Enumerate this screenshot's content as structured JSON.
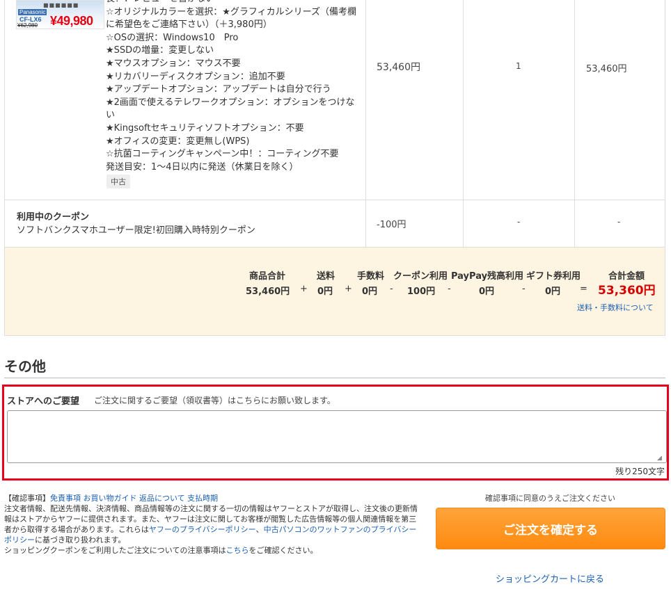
{
  "product": {
    "thumb_brand": "Panasonic",
    "thumb_model": "CF-LX6",
    "thumb_old_price": "¥62,980",
    "thumb_price": "¥49,980",
    "options": [
      "長！：レビューを書かない",
      "☆オリジナルカラーを選択：★グラフィカルシリーズ（備考欄に希望色をご連絡下さい）（＋3,980円）",
      "☆OSの選択：Windows10　Pro",
      "★SSDの増量：変更しない",
      "★マウスオプション：マウス不要",
      "★リカバリーディスクオプション：追加不要",
      "★アップデートオプション：アップデートは自分で行う",
      "★2画面で使えるテレワークオプション：オプションをつけない",
      "★Kingsoftセキュリティソフトオプション：不要",
      "★オフィスの変更：変更無し(WPS)",
      "☆抗菌コーティングキャンペーン中！：コーティング不要",
      "発送目安：1〜4日以内に発送（休業日を除く）"
    ],
    "condition_tag": "中古",
    "unit_price": "53,460円",
    "quantity": "1",
    "subtotal": "53,460円"
  },
  "coupon": {
    "title": "利用中のクーポン",
    "description": "ソフトバンクスマホユーザー限定!初回購入時特別クーポン",
    "discount": "-100円",
    "quantity": "-",
    "subtotal": "-"
  },
  "totals": {
    "headers": {
      "goods": "商品合計",
      "shipping": "送料",
      "fee": "手数料",
      "coupon": "クーポン利用",
      "paypay": "PayPay残高利用",
      "gift": "ギフト券利用",
      "total": "合計金額"
    },
    "values": {
      "goods": "53,460円",
      "shipping": "0円",
      "fee": "0円",
      "coupon": "100円",
      "paypay": "0円",
      "gift": "0円",
      "total": "53,360円"
    },
    "operators": [
      "+",
      "+",
      "-",
      "-",
      "-",
      "="
    ],
    "fee_link": "送料・手数料について"
  },
  "other": {
    "section_title": "その他",
    "request_label": "ストアへのご要望",
    "request_help": "ご注文に関するご要望（領収書等）はこちらにお願い致します。",
    "request_value": "",
    "request_remaining": "残り250文字"
  },
  "footer": {
    "notes_prefix": "【確認事項】",
    "links": {
      "disclaimer": "免責事項",
      "guide": "お買い物ガイド",
      "returns": "返品について",
      "payment": "支払時期"
    },
    "notes_body1": "注文者情報、配送先情報、決済情報、商品情報等の注文に関する一切の情報はヤフーとストアが取得し、注文後の更新情報はストアからヤフーに提供されます。また、ヤフーは注文に関してお客様が閲覧した広告情報等の個人関連情報を第三者から取得する場合があります。これらは",
    "yahoo_privacy": "ヤフーのプライバシーポリシー",
    "notes_sep": "、",
    "store_privacy": "中古パソコンのワットファンのプライバシーポリシー",
    "notes_body2": "に基づき取り扱われます。",
    "coupon_note_pre": "ショッピングクーポンをご利用したご注文についての注意事項は",
    "coupon_note_link": "こちら",
    "coupon_note_post": "をご確認ください。",
    "agree_note": "確認事項に同意のうえご注文ください",
    "order_button": "ご注文を確定する",
    "back_link": "ショッピングカートに戻る"
  },
  "colors": {
    "accent_red": "#d60000",
    "order_button": "#ff8a10",
    "link_blue": "#1a5fb4",
    "totals_bg": "#fdf4e1",
    "highlight_border": "#e8001c"
  }
}
